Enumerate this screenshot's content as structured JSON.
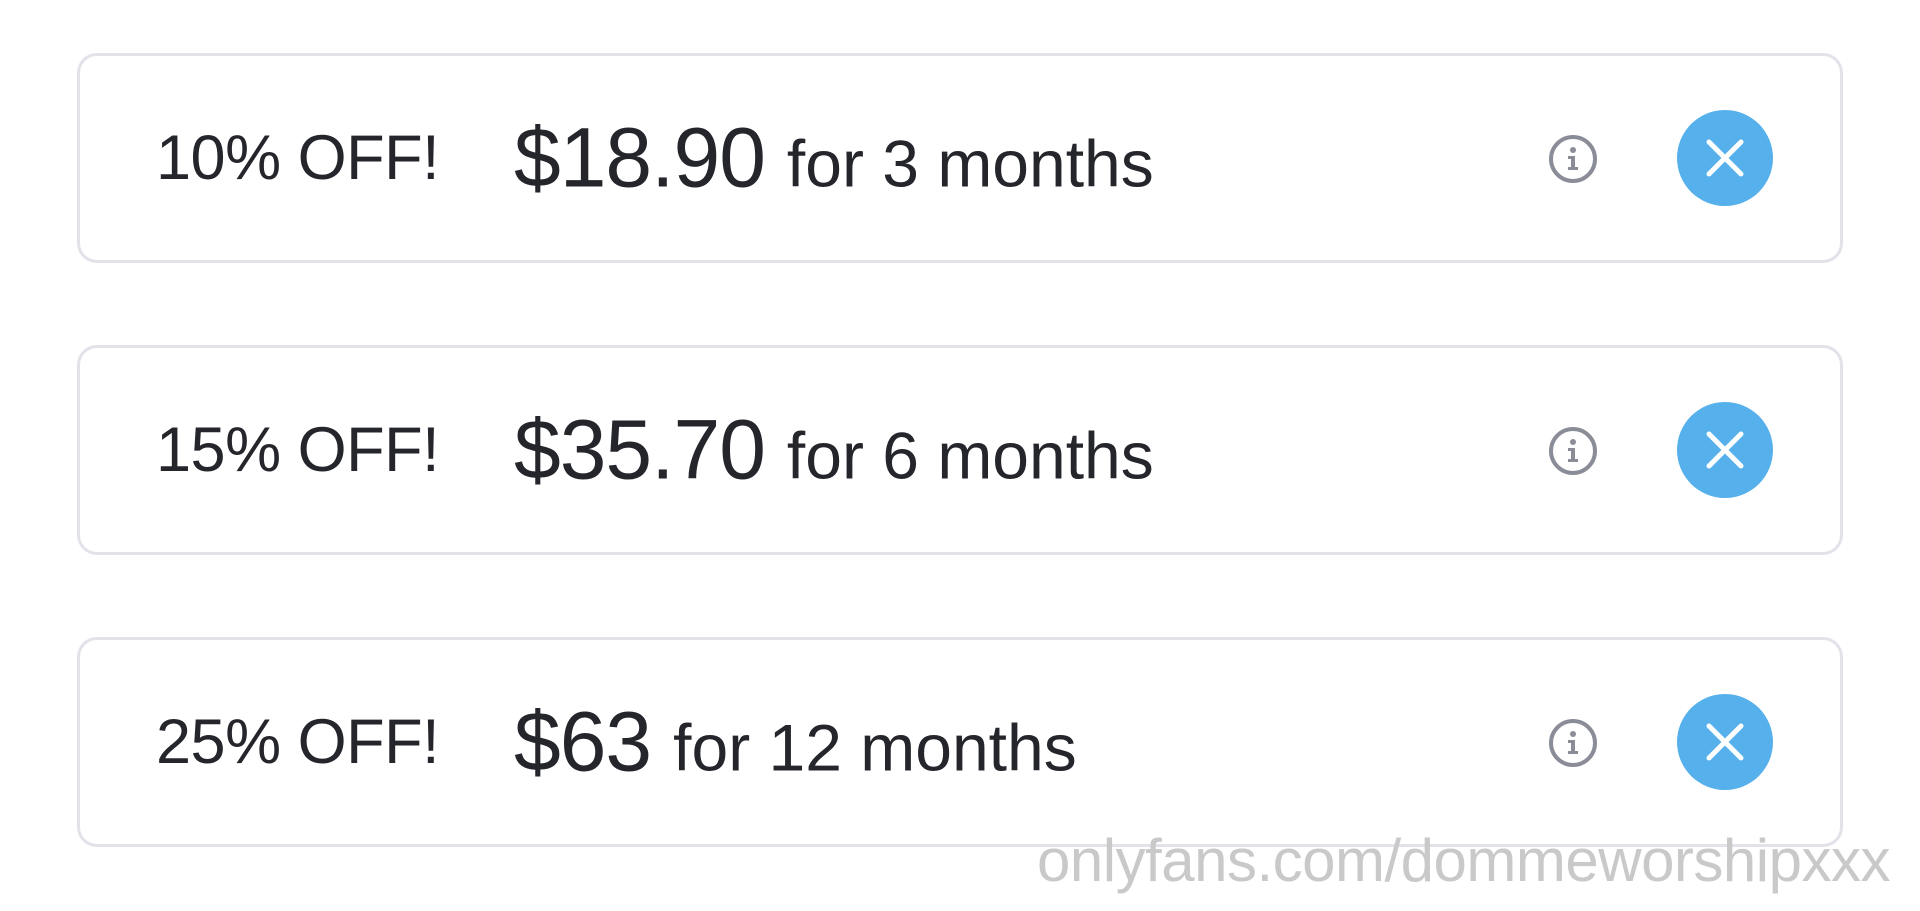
{
  "colors": {
    "text": "#25262c",
    "card_border": "#e2e3ea",
    "info_icon": "#8a8c98",
    "close_button": "#56b0ec",
    "watermark": "#c9c9c9"
  },
  "bundles": [
    {
      "discount": "10% OFF!",
      "price": "$18.90",
      "duration": "for 3 months",
      "info_icon": "info-icon",
      "close_icon": "close-icon"
    },
    {
      "discount": "15% OFF!",
      "price": "$35.70",
      "duration": "for 6 months",
      "info_icon": "info-icon",
      "close_icon": "close-icon"
    },
    {
      "discount": "25% OFF!",
      "price": "$63",
      "duration": "for 12 months",
      "info_icon": "info-icon",
      "close_icon": "close-icon"
    }
  ],
  "watermark": "onlyfans.com/dommeworshipxxx"
}
